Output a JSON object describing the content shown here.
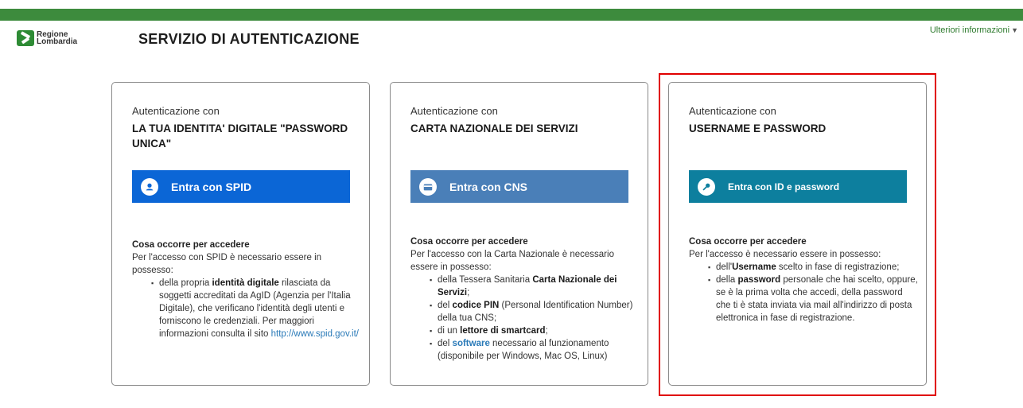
{
  "header": {
    "logo_line1": "Regione",
    "logo_line2": "Lombardia",
    "title": "SERVIZIO DI AUTENTICAZIONE",
    "more_info": "Ulteriori informazioni"
  },
  "colors": {
    "topbar": "#3d8b3d",
    "spid_button": "#0b66d6",
    "cns_button": "#4a7fb8",
    "id_button": "#0d7f9e",
    "highlight": "#e00000"
  },
  "cards": [
    {
      "intro": "Autenticazione con",
      "heading": "LA TUA IDENTITA' DIGITALE \"PASSWORD UNICA\"",
      "button_label": "Entra con SPID",
      "button_icon": "user-icon",
      "req_title": "Cosa occorre per accedere",
      "req_text": "Per l'accesso con SPID è necessario essere in possesso:",
      "items": [
        {
          "pre": "della propria ",
          "bold": "identità digitale",
          "post": " rilasciata da soggetti accreditati da AgID (Agenzia per l'Italia Digitale), che verificano l'identità degli utenti e forniscono le credenziali. Per maggiori informazioni consulta il sito ",
          "link": "http://www.spid.gov.it/"
        }
      ]
    },
    {
      "intro": "Autenticazione con",
      "heading": "CARTA NAZIONALE DEI SERVIZI",
      "button_label": "Entra con CNS",
      "button_icon": "card-icon",
      "req_title": "Cosa occorre per accedere",
      "req_text": "Per l'accesso con la Carta Nazionale è necessario essere in possesso:",
      "items": [
        {
          "pre": "della Tessera Sanitaria ",
          "bold": "Carta Nazionale dei Servizi",
          "post": ";"
        },
        {
          "pre": "del ",
          "bold": "codice PIN",
          "post": " (Personal Identification Number) della tua CNS;"
        },
        {
          "pre": "di un ",
          "bold": "lettore di smartcard",
          "post": ";"
        },
        {
          "pre": "del ",
          "bold": "software",
          "post": " necessario al funzionamento (disponibile per Windows, Mac OS, Linux)"
        }
      ]
    },
    {
      "intro": "Autenticazione con",
      "heading": "USERNAME E PASSWORD",
      "button_label": "Entra con ID e password",
      "button_icon": "key-icon",
      "req_title": "Cosa occorre per accedere",
      "req_text": "Per l'accesso è necessario essere in possesso:",
      "items": [
        {
          "pre": "dell'",
          "bold": "Username",
          "post": " scelto in fase di registrazione;"
        },
        {
          "pre": "della ",
          "bold": "password",
          "post": " personale che hai scelto, oppure, se è la prima volta che accedi, della password che ti è stata inviata via mail all'indirizzo di posta elettronica in fase di registrazione."
        }
      ]
    }
  ]
}
